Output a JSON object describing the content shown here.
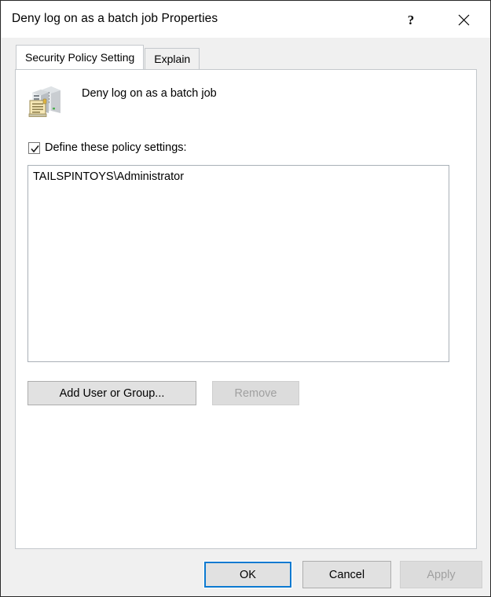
{
  "window": {
    "title": "Deny log on as a batch job Properties",
    "help_icon": "question-mark-icon",
    "help_glyph": "?",
    "close_icon": "close-icon"
  },
  "tabs": [
    {
      "label": "Security Policy Setting",
      "active": true
    },
    {
      "label": "Explain",
      "active": false
    }
  ],
  "content": {
    "icon": "policy-server-icon",
    "policy_name": "Deny log on as a batch job",
    "checkbox": {
      "label": "Define these policy settings:",
      "checked": true
    },
    "listbox": {
      "items": [
        "TAILSPINTOYS\\Administrator"
      ]
    },
    "buttons": {
      "add": "Add User or Group...",
      "remove": "Remove",
      "remove_enabled": false
    }
  },
  "footer": {
    "ok": "OK",
    "cancel": "Cancel",
    "apply": "Apply",
    "apply_enabled": false,
    "focus_color": "#0b79d0"
  }
}
